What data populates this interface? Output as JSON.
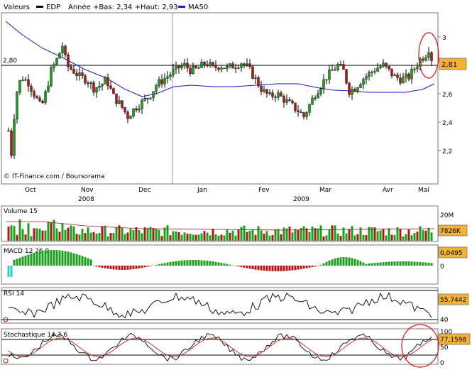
{
  "header": {
    "label_valeurs": "Valeurs",
    "label_symbol": "EDP",
    "label_range": "Année +Bas: 2,34 +Haut: 2,93",
    "label_ma": "MA50",
    "colors": {
      "ma_line": "#1a1acc",
      "symbol_swatch": "#000000"
    }
  },
  "watermark": "© IT-Finance.com / Boursorama",
  "x_axis": {
    "months": [
      "Oct",
      "Nov",
      "Dec",
      "Jan",
      "Fev",
      "Mar",
      "Avr",
      "Mai"
    ],
    "years": [
      "2008",
      "2009"
    ]
  },
  "panels": {
    "volume": {
      "title": "Volume 15",
      "scale_label": "20M",
      "value_label": "7826K"
    },
    "macd": {
      "title": "MACD 12 26 9",
      "value_label": "0,0495",
      "zero_label": "0"
    },
    "rsi": {
      "title": "RSI 14",
      "value_label": "55,7442",
      "level_label": "40"
    },
    "stoch": {
      "title": "Stochastique 14 3 6",
      "value_label": "77,1598",
      "levels": [
        "100",
        "50",
        "0"
      ]
    }
  },
  "chart_data": {
    "type": "candlestick",
    "price": {
      "yticks": [
        "2,2",
        "2,4",
        "2,6",
        "3"
      ],
      "ref_line_label": "2,80",
      "ref_line_value": 2.8,
      "last_label": "2,81",
      "ylim": [
        2.0,
        3.2
      ]
    },
    "colors": {
      "up": "#1e9e1e",
      "down": "#b01818",
      "ma": "#1a1acc",
      "stoch_signal": "#cc2222",
      "highlight": "#dd1111"
    }
  }
}
